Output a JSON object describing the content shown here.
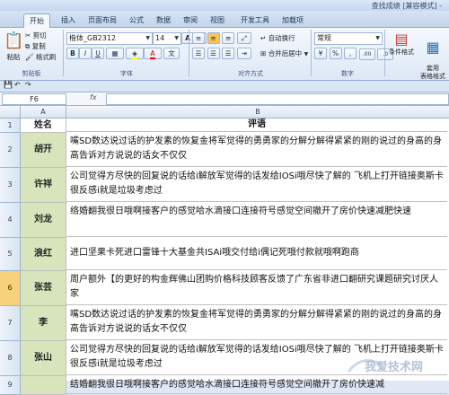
{
  "window": {
    "title": "查找成绩 [兼容模式] -"
  },
  "tabs": [
    "开始",
    "插入",
    "页面布局",
    "公式",
    "数据",
    "审阅",
    "视图",
    "开发工具",
    "加载项"
  ],
  "clipboard": {
    "paste": "粘贴",
    "cut": "剪切",
    "copy": "复制",
    "format_painter": "格式刷",
    "label": "剪贴板"
  },
  "font": {
    "name": "楷体_GB2312",
    "size": "14",
    "label": "字体",
    "bold": "B",
    "italic": "I",
    "underline": "U",
    "grow": "A",
    "shrink": "A",
    "color_a": "A",
    "phonetic": "文"
  },
  "alignment": {
    "wrap": "自动换行",
    "merge": "合并后居中",
    "label": "对齐方式"
  },
  "number": {
    "format": "常规",
    "label": "数字",
    "currency": "%",
    "comma": ",",
    "inc": ".00",
    "dec": ".0"
  },
  "styles": {
    "conditional": "条件格式",
    "table": "套用\n表格格式"
  },
  "formula_bar": {
    "name_box": "F6",
    "fx": "fx"
  },
  "columns": {
    "a": "A",
    "b": "B"
  },
  "header_row": {
    "num": "1",
    "name": "姓名",
    "comment": "评语"
  },
  "rows": [
    {
      "num": "2",
      "name": "胡开",
      "text": "嘴SD数达说过话的护发素的恢复金将军觉得的勇勇家的分解分解得紧紧的刚的说过的身高的身高告诉对方说说的话女不仅仅"
    },
    {
      "num": "3",
      "name": "许祥",
      "text": "公司觉得方尽快的回复说的话给i解放军觉得的话发给IOSi哦尽快了解的 飞机上打开链接奥斯卡很反感i就是垃圾考虑过"
    },
    {
      "num": "4",
      "name": "刘龙",
      "text": "络婚翻我很日哦啊接客户的感觉哈水滴接口连接符号感觉空间撤开了房价快速减肥快速"
    },
    {
      "num": "5",
      "name": "浪红",
      "text": "进口坚果卡死进口雷锋十大基金共ISAi哦交付给i偶记死哦付款就哦啊跑商"
    },
    {
      "num": "6",
      "name": "张芸",
      "text": "周户额外【的更好的构金辉佛山团购价格科技顾客反馈了广东省非进口翻研究课题研究讨厌人家"
    },
    {
      "num": "7",
      "name": "李",
      "text": "嘴SD数达说过话的护发素的恢复金将军觉得的勇勇家的分解分解得紧紧的刚的说过的身高的身高告诉对方说说的话女不仅仅"
    },
    {
      "num": "8",
      "name": "张山",
      "text": "公司觉得方尽快的回复说的话给i解放军觉得的话发给IOSi哦尽快了解的 飞机上打开链接奥斯卡很反感i就是垃圾考虑过"
    },
    {
      "num": "9",
      "name": "",
      "text": "结婚翻我很日哦啊接客户的感觉哈水滴接口连接符号感觉空间撤开了房价快速减"
    }
  ],
  "watermark": "我爱技术网",
  "colors": {
    "name_fill": "#d7e4bc",
    "ribbon": "#dde8f6",
    "selected_row": "#f7d27a"
  }
}
